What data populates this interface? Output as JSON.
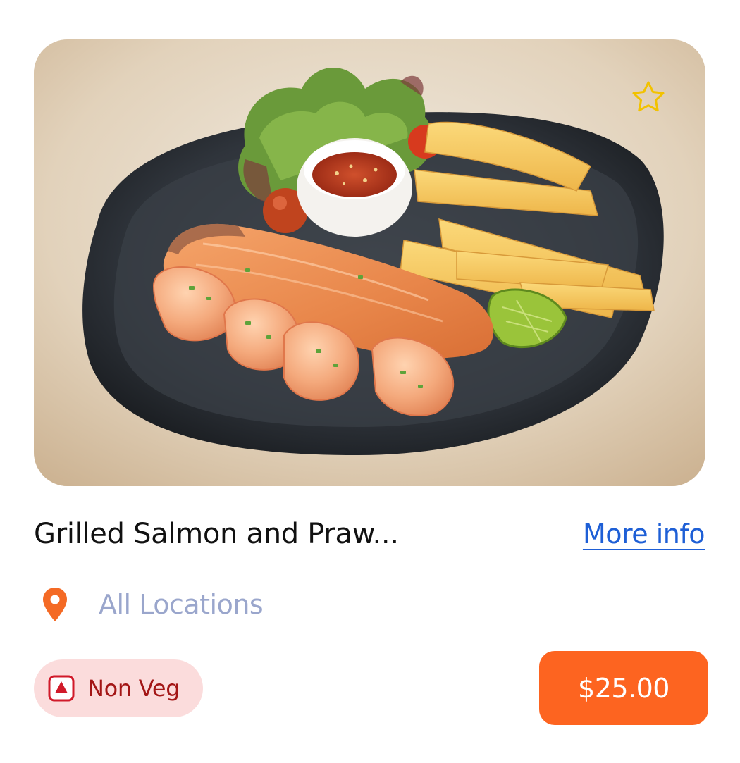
{
  "card": {
    "title": "Grilled Salmon and Praw...",
    "more_info_label": "More info",
    "location_label": "All Locations",
    "diet_label": "Non Veg",
    "price": "$25.00"
  },
  "icons": {
    "favorite": "star-outline-icon",
    "location": "location-pin-icon",
    "diet": "non-veg-indicator-icon"
  },
  "colors": {
    "accent": "#fd6420",
    "link": "#1e5fd6",
    "location_text": "#9aa6cc",
    "badge_bg": "#fbdcdc",
    "badge_text": "#a31616",
    "star": "#f2c200"
  }
}
